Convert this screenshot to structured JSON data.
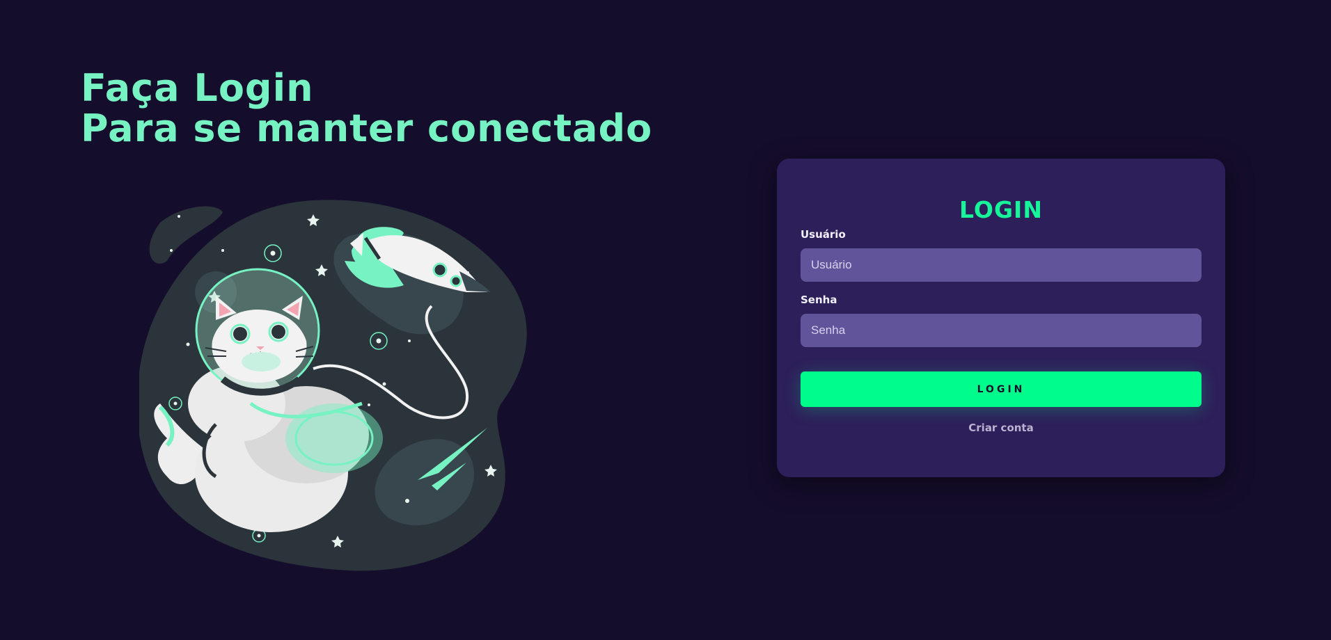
{
  "hero": {
    "line1": "Faça Login",
    "line2": "Para se manter conectado"
  },
  "illustration": {
    "subject": "cat-astronaut-icon",
    "palette": {
      "blob": "#2a343a",
      "accent": "#77f2c3",
      "suit": "#f0f0f0"
    }
  },
  "login_card": {
    "title": "LOGIN",
    "username_label": "Usuário",
    "username_placeholder": "Usuário",
    "username_value": "",
    "password_label": "Senha",
    "password_placeholder": "Senha",
    "password_value": "",
    "submit_label": "LOGIN",
    "create_account_label": "Criar conta"
  },
  "colors": {
    "background": "#150d2c",
    "card": "#2d1f5a",
    "input": "#62549a",
    "accent": "#00fd8b",
    "heading": "#77f2c3"
  }
}
